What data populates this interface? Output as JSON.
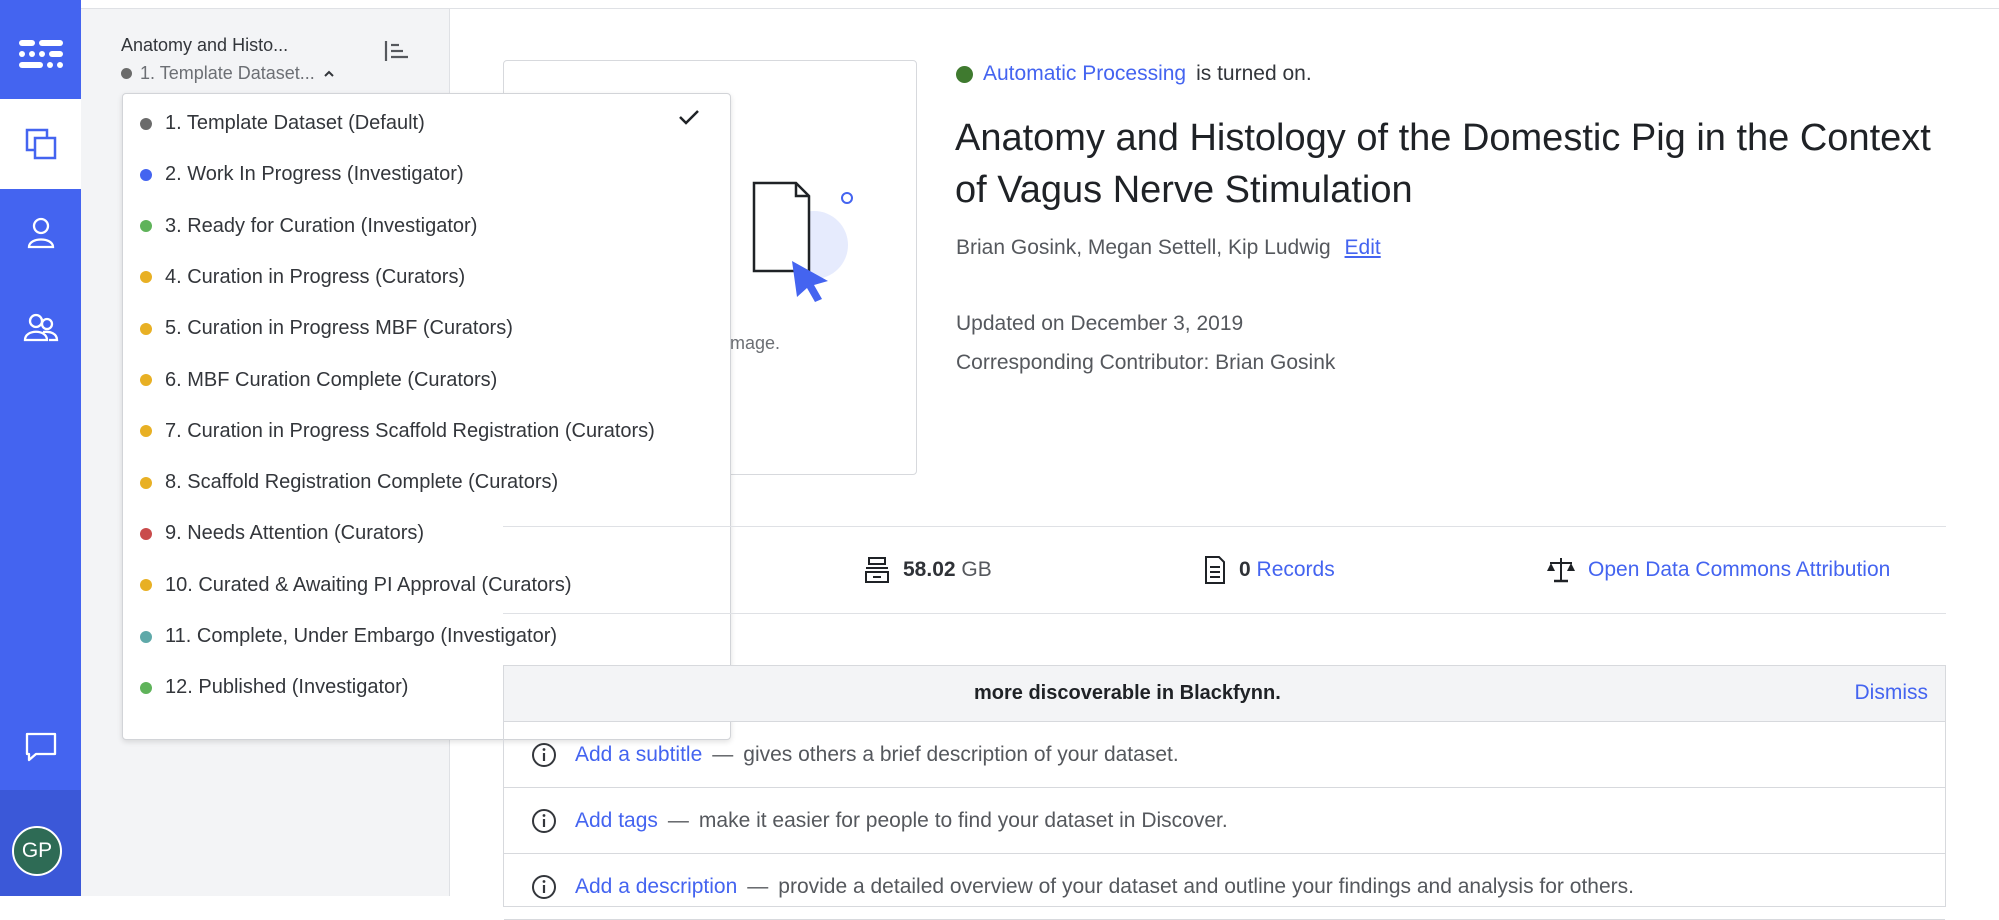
{
  "sidebar": {
    "dataset_title": "Anatomy and Histo...",
    "status_label": "1. Template Dataset..."
  },
  "rail": {
    "avatar_initials": "GP"
  },
  "status_dropdown": {
    "items": [
      {
        "label": "1. Template Dataset (Default)",
        "color": "#6b6b6b",
        "selected": true
      },
      {
        "label": "2. Work In Progress (Investigator)",
        "color": "#4464f0"
      },
      {
        "label": "3. Ready for Curation (Investigator)",
        "color": "#5fb35a"
      },
      {
        "label": "4. Curation in Progress (Curators)",
        "color": "#e8b024"
      },
      {
        "label": "5. Curation in Progress MBF (Curators)",
        "color": "#e8b024"
      },
      {
        "label": "6. MBF Curation Complete (Curators)",
        "color": "#e8b024"
      },
      {
        "label": "7. Curation in Progress Scaffold Registration (Curators)",
        "color": "#e8b024"
      },
      {
        "label": "8. Scaffold Registration Complete (Curators)",
        "color": "#e8b024"
      },
      {
        "label": "9. Needs Attention (Curators)",
        "color": "#c94b4b"
      },
      {
        "label": "10. Curated & Awaiting PI Approval (Curators)",
        "color": "#e8b024"
      },
      {
        "label": "11. Complete, Under Embargo (Investigator)",
        "color": "#5fa9a9"
      },
      {
        "label": "12. Published (Investigator)",
        "color": "#5fb35a"
      }
    ]
  },
  "banner_card": {
    "hint_text": "r image."
  },
  "processing": {
    "link": "Automatic Processing",
    "suffix": "is turned on."
  },
  "dataset": {
    "title": "Anatomy and Histology of the Domestic Pig in the Context of Vagus Nerve Stimulation",
    "authors": "Brian Gosink, Megan Settell, Kip Ludwig",
    "edit_label": "Edit",
    "updated": "Updated on December 3, 2019",
    "contributor_label": "Corresponding Contributor:",
    "contributor_name": "Brian Gosink"
  },
  "stats": {
    "size_value": "58.02",
    "size_unit": "GB",
    "records_count": "0",
    "records_label": "Records",
    "license": "Open Data Commons Attribution"
  },
  "discoverable": {
    "heading": "more discoverable in Blackfynn.",
    "dismiss": "Dismiss",
    "rows": [
      {
        "link": "Add a subtitle",
        "desc": "gives others a brief description of your dataset."
      },
      {
        "link": "Add tags",
        "desc": "make it easier for people to find your dataset in Discover."
      },
      {
        "link": "Add a description",
        "desc": "provide a detailed overview of your dataset and outline your findings and analysis for others."
      }
    ],
    "dash": "—"
  },
  "colors": {
    "accent": "#4464f0",
    "rail": "#4464f0",
    "processing_on": "#3f7a2f"
  }
}
